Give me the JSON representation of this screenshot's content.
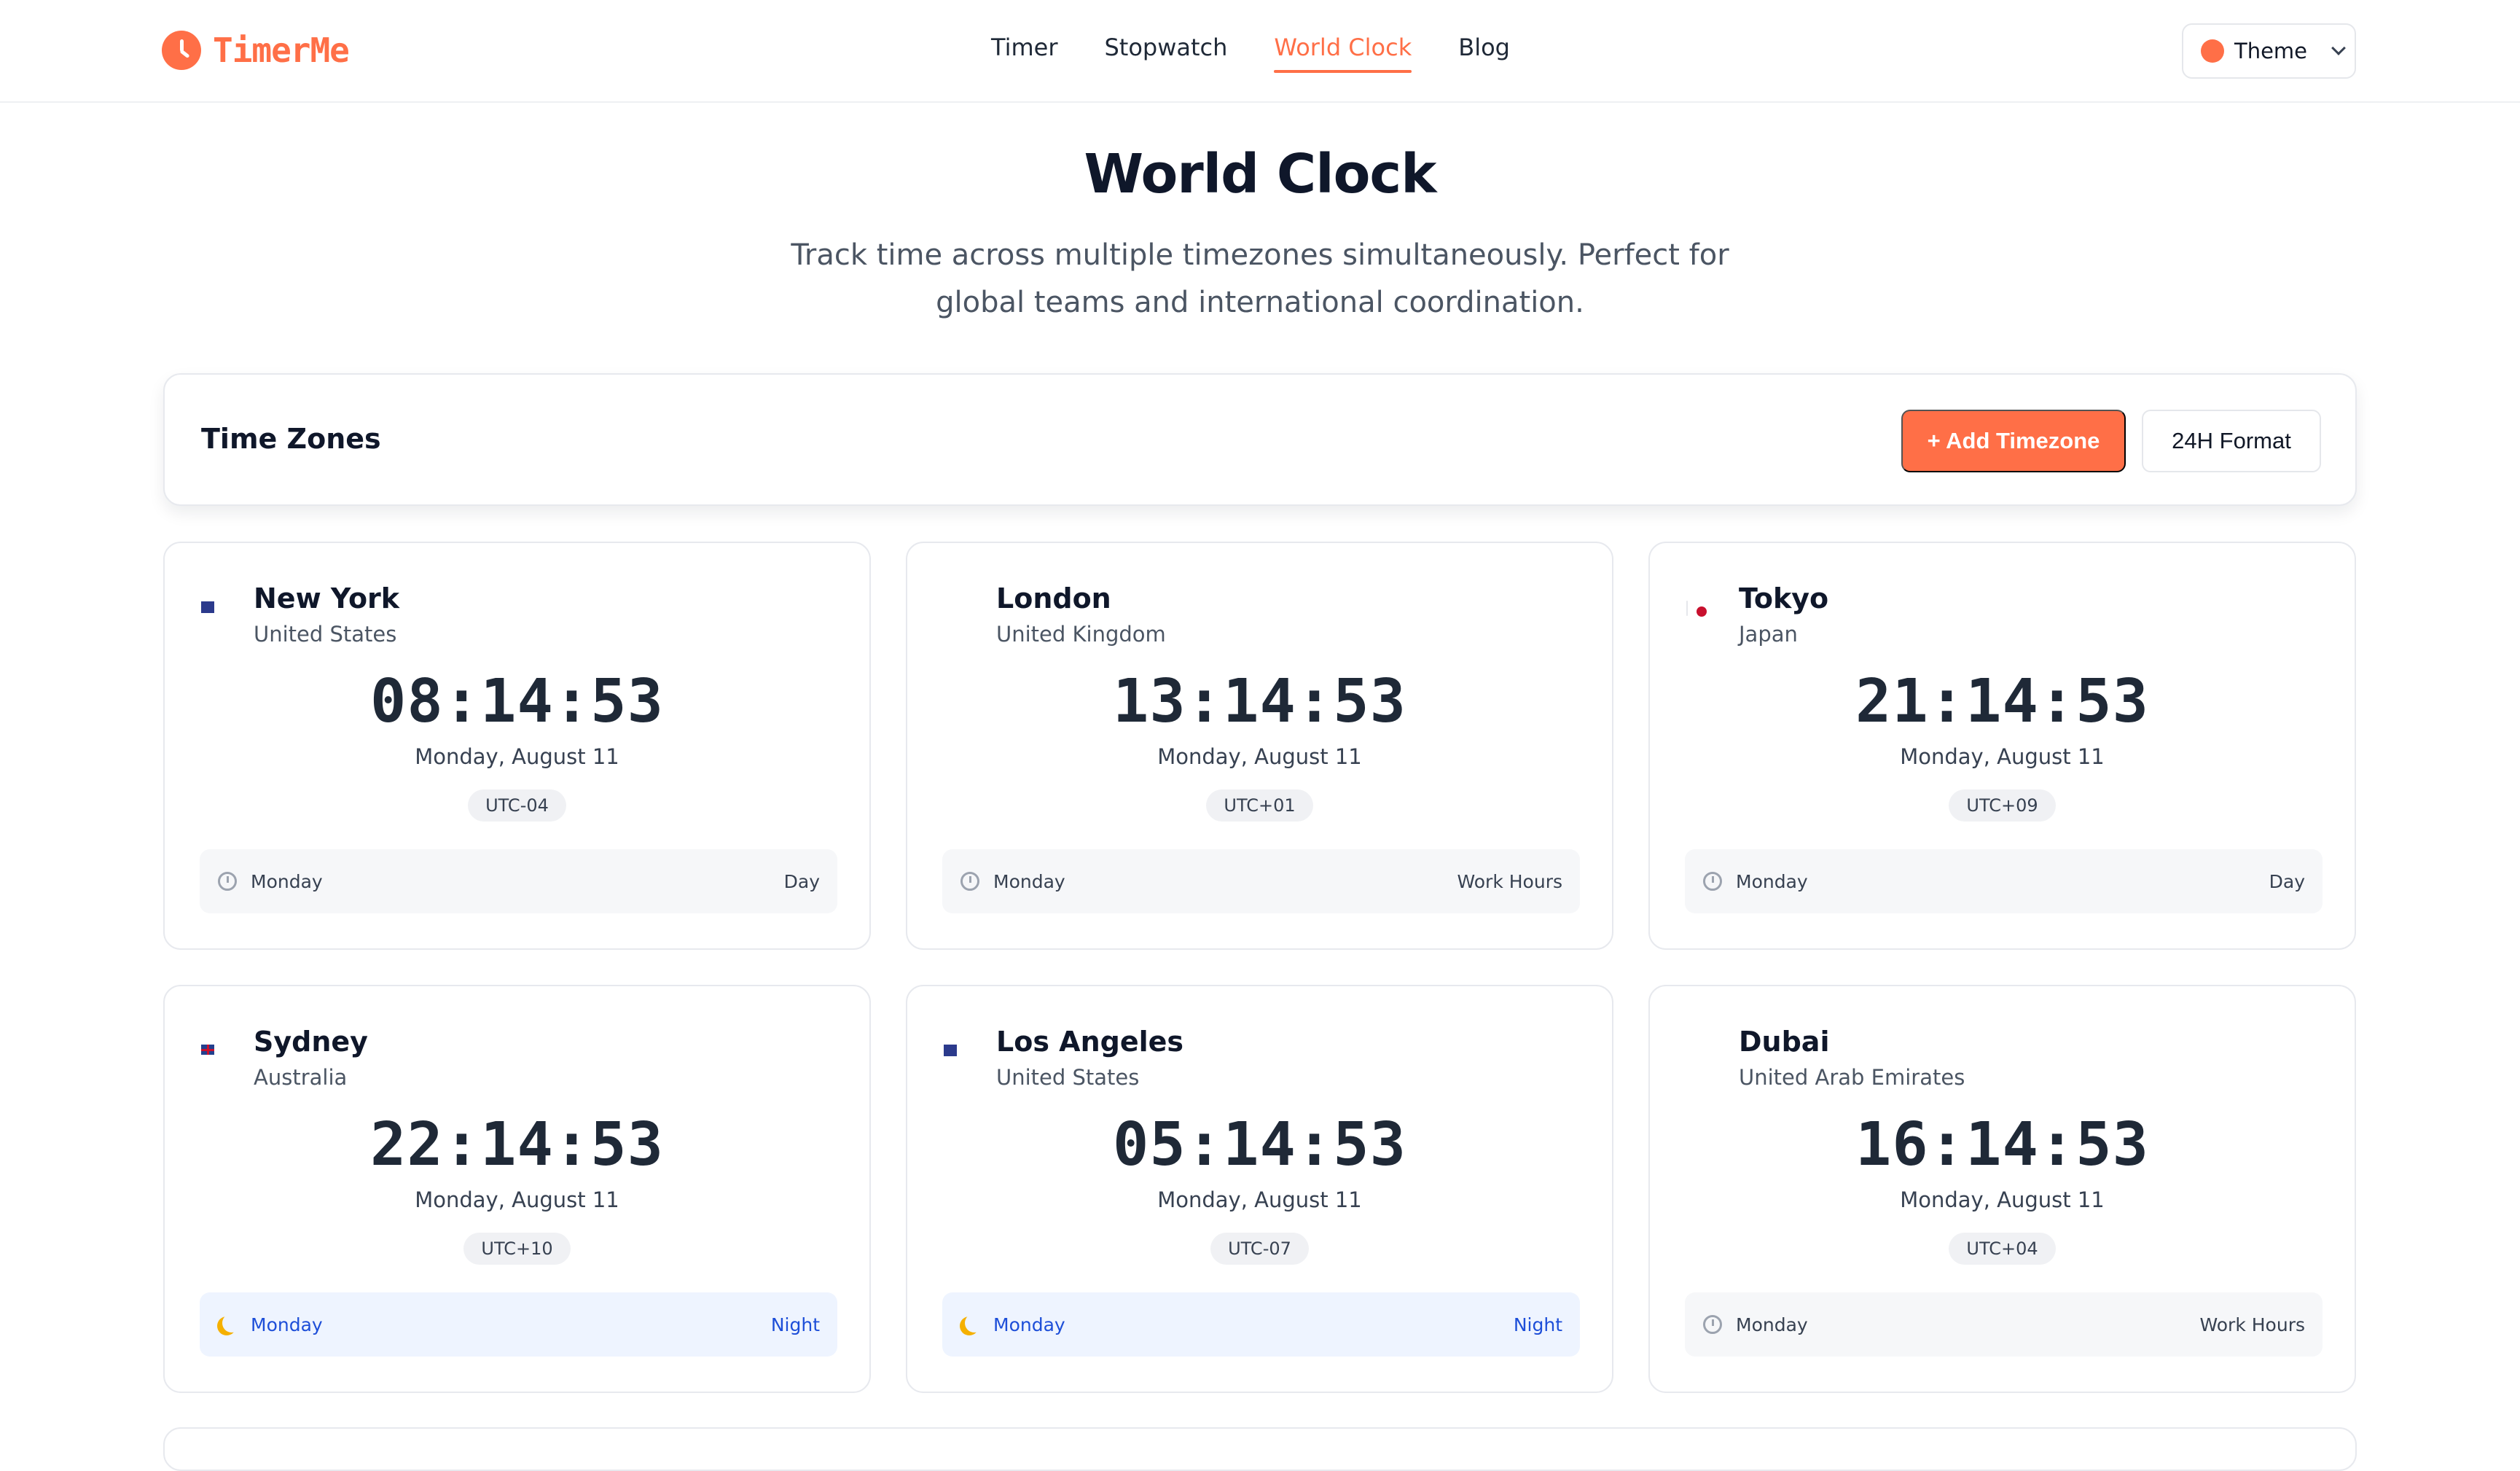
{
  "app": {
    "name": "TimerMe"
  },
  "nav": {
    "items": [
      {
        "label": "Timer",
        "active": false
      },
      {
        "label": "Stopwatch",
        "active": false
      },
      {
        "label": "World Clock",
        "active": true
      },
      {
        "label": "Blog",
        "active": false
      }
    ],
    "theme_label": "Theme"
  },
  "hero": {
    "title": "World Clock",
    "subtitle": "Track time across multiple timezones simultaneously. Perfect for global teams and international coordination."
  },
  "toolbar": {
    "title": "Time Zones",
    "add_label": "+ Add Timezone",
    "format_label": "24H Format"
  },
  "colors": {
    "accent": "#ff6f47",
    "night_bg": "#eef4ff",
    "night_text": "#1d4ed8"
  },
  "clocks": [
    {
      "city": "New York",
      "country": "United States",
      "flag": "flag-us",
      "time": "08:14:53",
      "date": "Monday, August 11",
      "utc": "UTC-04",
      "day": "Monday",
      "period": "Day",
      "night": false
    },
    {
      "city": "London",
      "country": "United Kingdom",
      "flag": "flag-uk",
      "time": "13:14:53",
      "date": "Monday, August 11",
      "utc": "UTC+01",
      "day": "Monday",
      "period": "Work Hours",
      "night": false
    },
    {
      "city": "Tokyo",
      "country": "Japan",
      "flag": "flag-jp",
      "time": "21:14:53",
      "date": "Monday, August 11",
      "utc": "UTC+09",
      "day": "Monday",
      "period": "Day",
      "night": false
    },
    {
      "city": "Sydney",
      "country": "Australia",
      "flag": "flag-au",
      "time": "22:14:53",
      "date": "Monday, August 11",
      "utc": "UTC+10",
      "day": "Monday",
      "period": "Night",
      "night": true
    },
    {
      "city": "Los Angeles",
      "country": "United States",
      "flag": "flag-us",
      "time": "05:14:53",
      "date": "Monday, August 11",
      "utc": "UTC-07",
      "day": "Monday",
      "period": "Night",
      "night": true
    },
    {
      "city": "Dubai",
      "country": "United Arab Emirates",
      "flag": "flag-ae",
      "time": "16:14:53",
      "date": "Monday, August 11",
      "utc": "UTC+04",
      "day": "Monday",
      "period": "Work Hours",
      "night": false
    }
  ]
}
